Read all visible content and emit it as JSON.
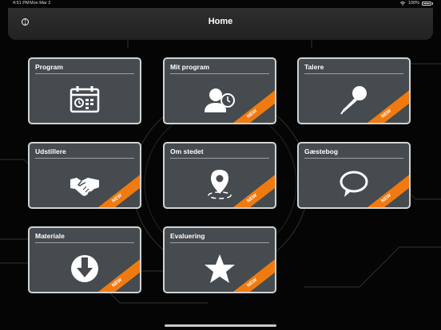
{
  "status_bar": {
    "time": "4:51 PM",
    "date": "Mon Mar 2",
    "battery": "100%"
  },
  "header": {
    "title": "Home"
  },
  "tiles": [
    {
      "label": "Program",
      "icon": "calendar-icon",
      "badge": ""
    },
    {
      "label": "Mit program",
      "icon": "user-clock-icon",
      "badge": "NEW"
    },
    {
      "label": "Talere",
      "icon": "microphone-icon",
      "badge": "NEW"
    },
    {
      "label": "Udstillere",
      "icon": "handshake-icon",
      "badge": "NEW"
    },
    {
      "label": "Om stedet",
      "icon": "location-pin-icon",
      "badge": "NEW"
    },
    {
      "label": "Gæstebog",
      "icon": "speech-bubble-icon",
      "badge": "NEW"
    },
    {
      "label": "Materiale",
      "icon": "download-icon",
      "badge": "NEW"
    },
    {
      "label": "Evaluering",
      "icon": "star-icon",
      "badge": "NEW"
    }
  ],
  "colors": {
    "tile_bg": "#454b4f",
    "ribbon": "#f07a10",
    "tile_border": "#d0d3d4"
  }
}
